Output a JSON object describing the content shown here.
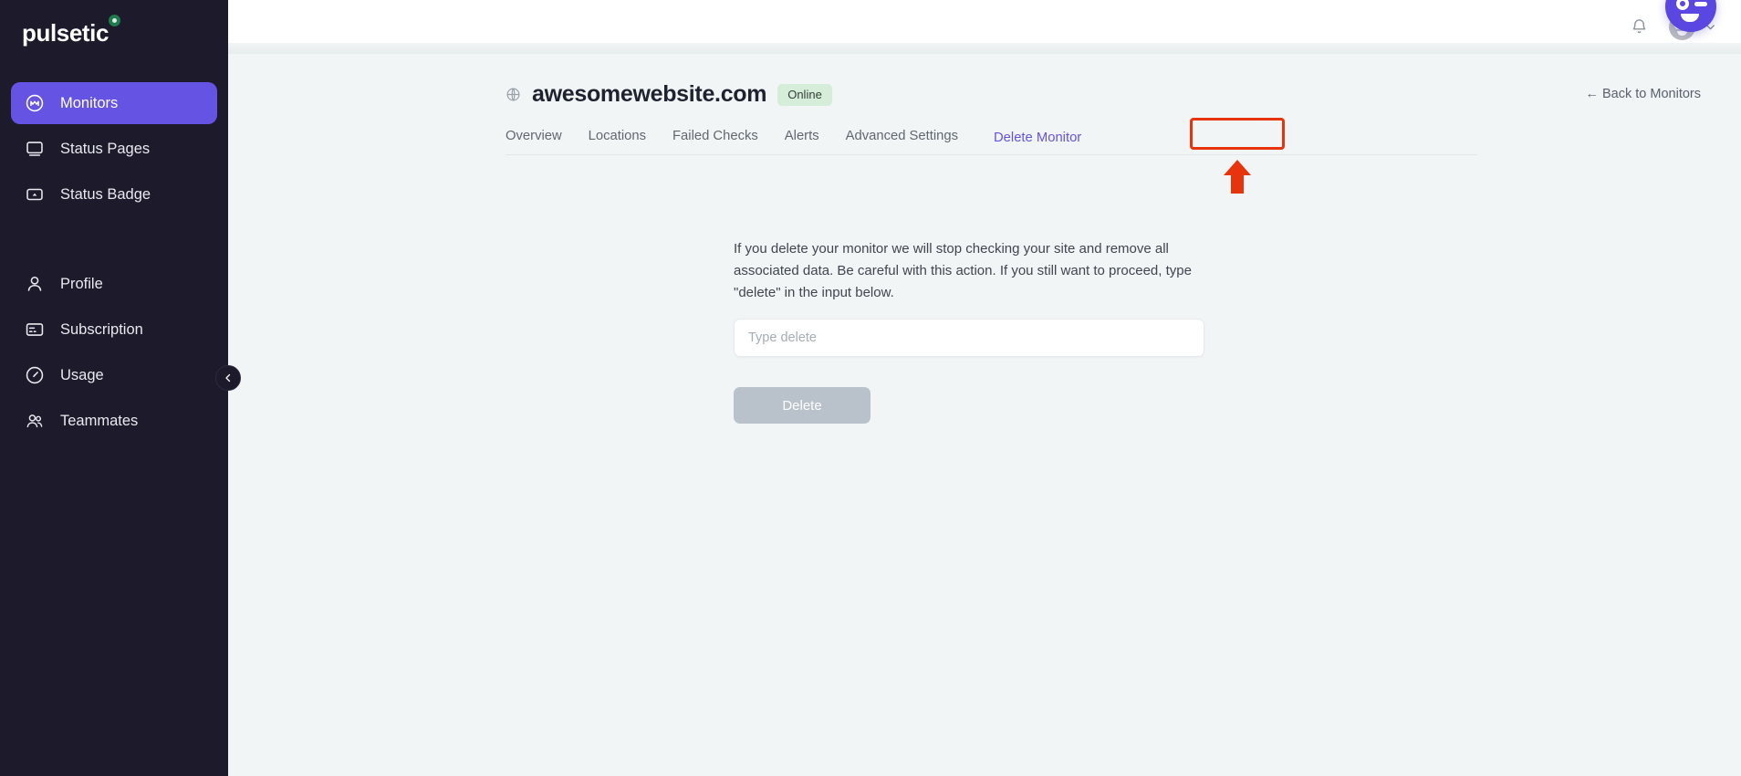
{
  "brand": {
    "name": "pulsetic",
    "accent": "#6553e4",
    "sidebar_bg": "#1c1a2b"
  },
  "sidebar": {
    "primary_items": [
      {
        "label": "Monitors",
        "icon": "monitor-pulse-icon",
        "active": true
      },
      {
        "label": "Status Pages",
        "icon": "display-icon",
        "active": false
      },
      {
        "label": "Status Badge",
        "icon": "badge-icon",
        "active": false
      }
    ],
    "secondary_items": [
      {
        "label": "Profile",
        "icon": "user-icon"
      },
      {
        "label": "Subscription",
        "icon": "credit-card-icon"
      },
      {
        "label": "Usage",
        "icon": "gauge-icon"
      },
      {
        "label": "Teammates",
        "icon": "users-icon"
      }
    ],
    "collapse_icon": "chevron-left-icon"
  },
  "topbar": {
    "notifications_icon": "bell-icon",
    "avatar_icon": "avatar-face-icon",
    "account_chevron_icon": "chevron-down-icon"
  },
  "monitor": {
    "site_icon": "globe-icon",
    "name": "awesomewebsite.com",
    "status": "Online",
    "status_color": "#d6edd9",
    "back_link": "← Back to Monitors"
  },
  "tabs": [
    {
      "label": "Overview",
      "active": false
    },
    {
      "label": "Locations",
      "active": false
    },
    {
      "label": "Failed Checks",
      "active": false
    },
    {
      "label": "Alerts",
      "active": false
    },
    {
      "label": "Advanced Settings",
      "active": false
    },
    {
      "label": "Delete Monitor",
      "active": true
    }
  ],
  "delete_panel": {
    "description": "If you delete your monitor we will stop checking your site and remove all associated data. Be careful with this action. If you still want to proceed, type \"delete\" in the input below.",
    "input_placeholder": "Type delete",
    "input_value": "",
    "submit_label": "Delete",
    "submit_disabled": true
  },
  "annotation": {
    "highlight_color": "#e8340c",
    "arrow_icon": "up-arrow-annotation"
  },
  "chat": {
    "icon": "chat-face-icon",
    "color": "#5a46e0"
  }
}
